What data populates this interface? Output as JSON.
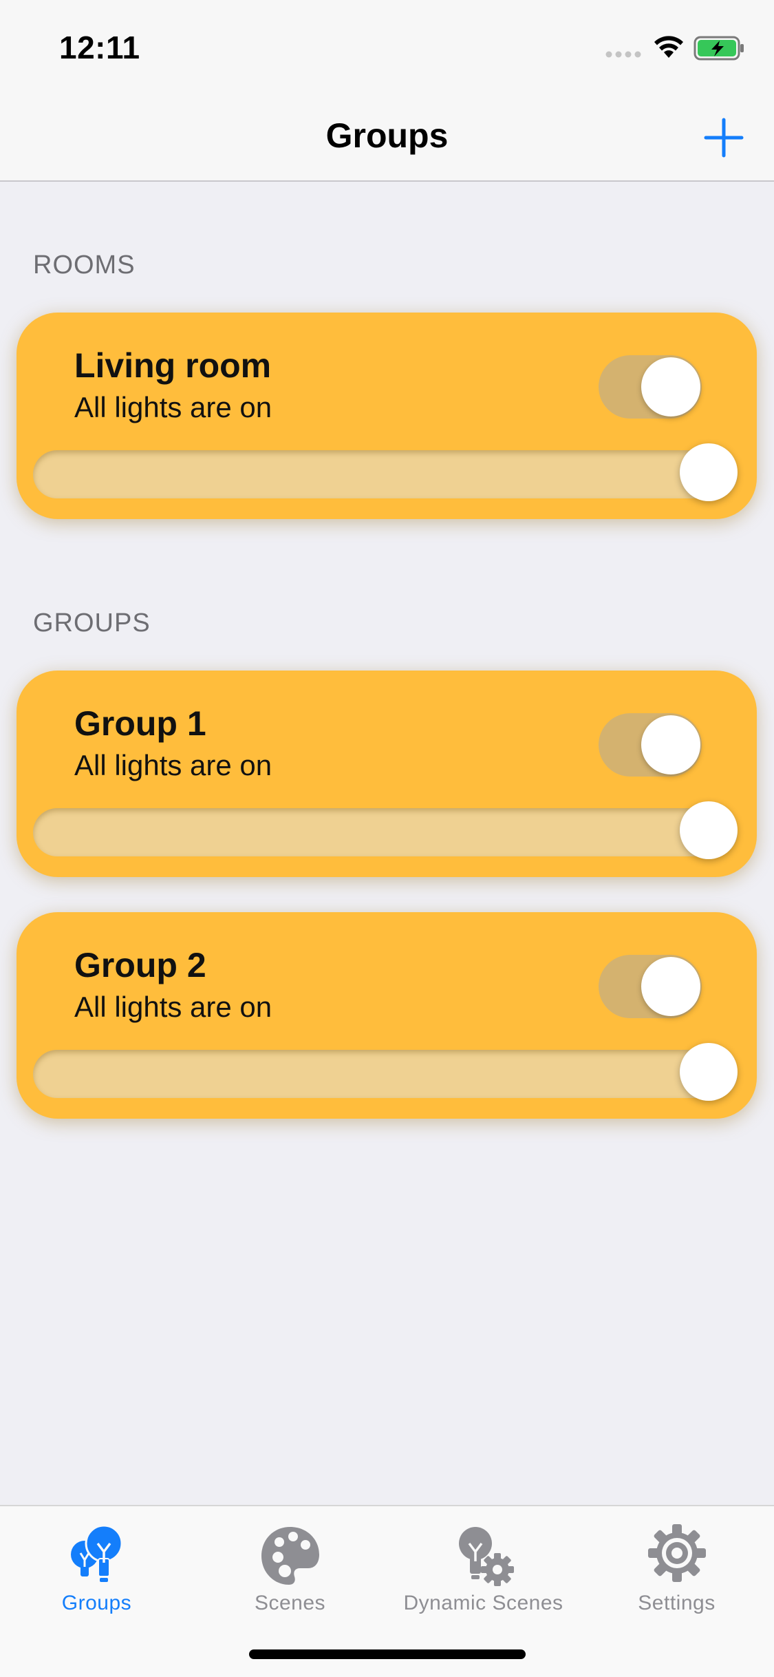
{
  "status_bar": {
    "time": "12:11"
  },
  "nav": {
    "title": "Groups",
    "add_icon": "plus-icon"
  },
  "colors": {
    "accent": "#147efb",
    "card": "#ffbd3c",
    "track": "#efd192",
    "toggle_on": "#d4b26f",
    "inactive_tab": "#8e8e93"
  },
  "sections": [
    {
      "header": "ROOMS",
      "cards": [
        {
          "title": "Living room",
          "subtitle": "All lights are on",
          "on": true,
          "brightness": 1.0
        }
      ]
    },
    {
      "header": "GROUPS",
      "cards": [
        {
          "title": "Group 1",
          "subtitle": "All lights are on",
          "on": true,
          "brightness": 1.0
        },
        {
          "title": "Group 2",
          "subtitle": "All lights are on",
          "on": true,
          "brightness": 1.0
        }
      ]
    }
  ],
  "tabs": [
    {
      "label": "Groups",
      "icon": "lightbulbs-icon",
      "active": true
    },
    {
      "label": "Scenes",
      "icon": "palette-icon",
      "active": false
    },
    {
      "label": "Dynamic Scenes",
      "icon": "bulb-gear-icon",
      "active": false
    },
    {
      "label": "Settings",
      "icon": "gear-icon",
      "active": false
    }
  ]
}
